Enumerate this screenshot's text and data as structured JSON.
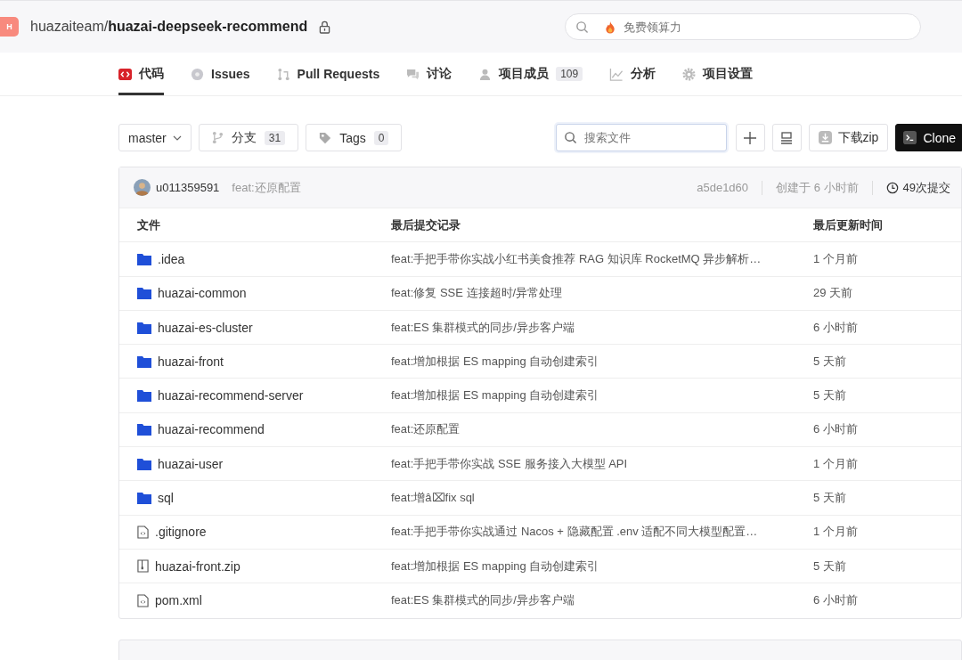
{
  "header": {
    "avatar_letter": "H",
    "owner": "huazaiteam/",
    "repo": "huazai-deepseek-recommend",
    "private": true,
    "search": {
      "placeholder": "免费领算力"
    }
  },
  "tabs": [
    {
      "label": "代码",
      "kind": "code",
      "selected": true
    },
    {
      "label": "Issues",
      "kind": "issue",
      "selected": false
    },
    {
      "label": "Pull Requests",
      "kind": "pr",
      "selected": false
    },
    {
      "label": "讨论",
      "kind": "chat",
      "selected": false
    },
    {
      "label": "项目成员",
      "kind": "user",
      "count": "109",
      "selected": false
    },
    {
      "label": "分析",
      "kind": "chart",
      "selected": false
    },
    {
      "label": "项目设置",
      "kind": "gear",
      "selected": false
    }
  ],
  "toolbar": {
    "branch": "master",
    "branches": {
      "label": "分支",
      "count": "31"
    },
    "tags": {
      "label": "Tags",
      "count": "0"
    },
    "file_search": {
      "placeholder": "搜索文件"
    },
    "download": "下载zip",
    "clone": "Clone"
  },
  "commit": {
    "author": "u011359591",
    "message": "feat:还原配置",
    "hash": "a5de1d60",
    "created": "创建于 6 小时前",
    "commits": "49次提交"
  },
  "table": {
    "columns": [
      "文件",
      "最后提交记录",
      "最后更新时间"
    ],
    "rows": [
      {
        "kind": "folder",
        "name": ".idea",
        "message": "feat:手把手带你实战小红书美食推荐 RAG 知识库 RocketMQ 异步解析…",
        "time": "1 个月前"
      },
      {
        "kind": "folder",
        "name": "huazai-common",
        "message": "feat:修复 SSE 连接超时/异常处理",
        "time": "29 天前"
      },
      {
        "kind": "folder",
        "name": "huazai-es-cluster",
        "message": "feat:ES 集群模式的同步/异步客户端",
        "time": "6 小时前"
      },
      {
        "kind": "folder",
        "name": "huazai-front",
        "message": "feat:增加根据 ES mapping 自动创建索引",
        "time": "5 天前"
      },
      {
        "kind": "folder",
        "name": "huazai-recommend-server",
        "message": "feat:增加根据 ES mapping 自动创建索引",
        "time": "5 天前"
      },
      {
        "kind": "folder",
        "name": "huazai-recommend",
        "message": "feat:还原配置",
        "time": "6 小时前"
      },
      {
        "kind": "folder",
        "name": "huazai-user",
        "message": "feat:手把手带你实战 SSE 服务接入大模型 API",
        "time": "1 个月前"
      },
      {
        "kind": "folder",
        "name": "sql",
        "message": "feat:增â⌧fix sql",
        "time": "5 天前"
      },
      {
        "kind": "file",
        "name": ".gitignore",
        "message": "feat:手把手带你实战通过 Nacos + 隐藏配置 .env 适配不同大模型配置…",
        "time": "1 个月前"
      },
      {
        "kind": "archive",
        "name": "huazai-front.zip",
        "message": "feat:增加根据 ES mapping 自动创建索引",
        "time": "5 天前"
      },
      {
        "kind": "file",
        "name": "pom.xml",
        "message": "feat:ES 集群模式的同步/异步客户端",
        "time": "6 小时前"
      }
    ]
  }
}
